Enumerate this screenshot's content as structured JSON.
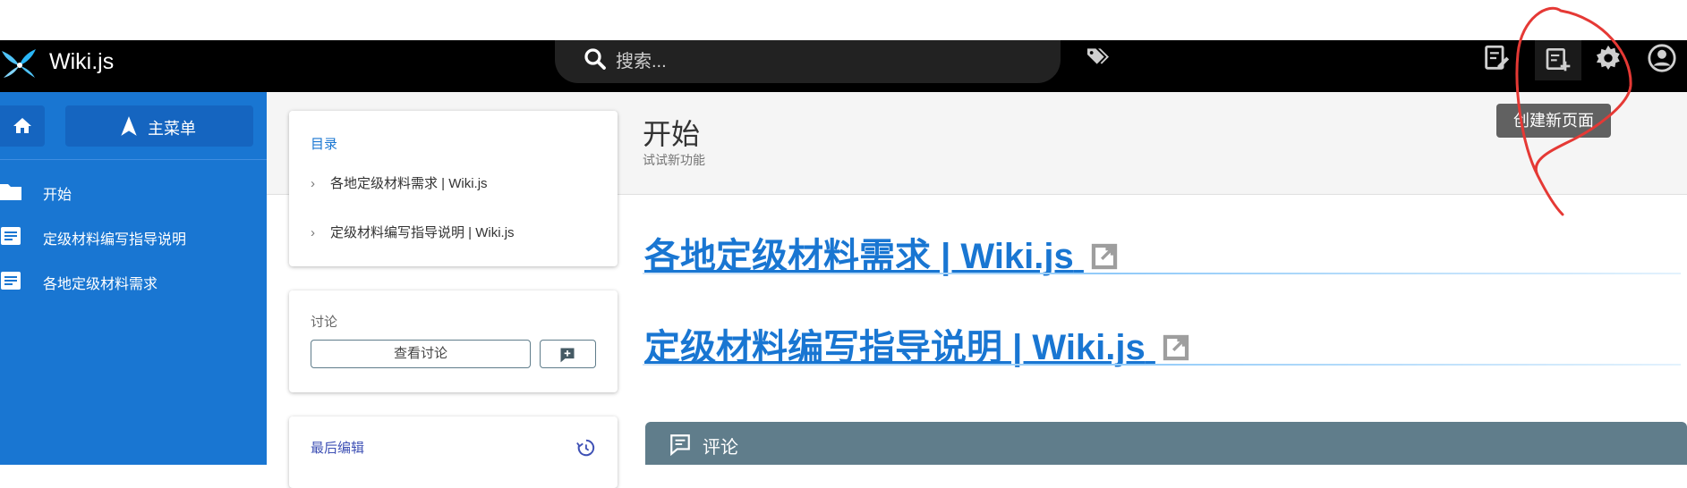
{
  "app": {
    "title": "Wiki.js"
  },
  "search": {
    "placeholder": "搜索..."
  },
  "header_icons": [
    "tags-icon",
    "edit-page-icon",
    "new-page-icon",
    "settings-icon",
    "account-icon"
  ],
  "sidebar": {
    "menu_label": "主菜单",
    "items": [
      {
        "label": "开始",
        "icon": "folder-icon"
      },
      {
        "label": "定级材料编写指导说明",
        "icon": "document-icon"
      },
      {
        "label": "各地定级材料需求",
        "icon": "document-icon"
      }
    ]
  },
  "toc": {
    "title": "目录",
    "items": [
      "各地定级材料需求 | Wiki.js",
      "定级材料编写指导说明 | Wiki.js"
    ]
  },
  "discussion": {
    "title": "讨论",
    "view_label": "查看讨论"
  },
  "last_edit": {
    "title": "最后编辑"
  },
  "page": {
    "title": "开始",
    "subtitle": "试试新功能"
  },
  "tooltip": {
    "text": "创建新页面"
  },
  "content": {
    "links": [
      "各地定级材料需求 | Wiki.js",
      "定级材料编写指导说明 | Wiki.js"
    ]
  },
  "comments": {
    "label": "评论"
  },
  "colors": {
    "topbar": "#000000",
    "sidebar": "#1976d2",
    "link": "#1976d2",
    "comments_bar": "#607d8b",
    "annotation": "#e53935"
  }
}
